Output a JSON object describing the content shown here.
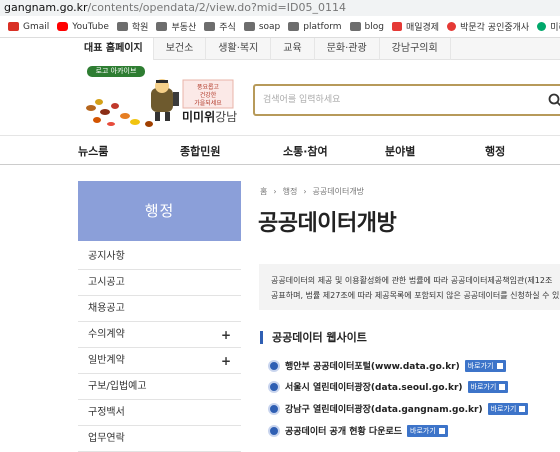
{
  "browser": {
    "url_host": "gangnam.go.kr",
    "url_path": "/contents/opendata/2/view.do?mid=ID05_0114",
    "bookmarks": [
      {
        "label": "Gmail",
        "icon": "gmail-icon",
        "color": "#d93025"
      },
      {
        "label": "YouTube",
        "icon": "youtube-icon",
        "color": "#ff0000"
      },
      {
        "label": "학원",
        "icon": "folder-icon"
      },
      {
        "label": "부동산",
        "icon": "folder-icon"
      },
      {
        "label": "주식",
        "icon": "folder-icon"
      },
      {
        "label": "soap",
        "icon": "folder-icon"
      },
      {
        "label": "platform",
        "icon": "folder-icon"
      },
      {
        "label": "blog",
        "icon": "folder-icon"
      },
      {
        "label": "매일경제",
        "icon": "maeil-icon",
        "color": "#e53935"
      },
      {
        "label": "박문각 공인중개사",
        "icon": "pmg-icon",
        "color": "#e53935"
      },
      {
        "label": "미리캔버스",
        "icon": "miricanvas-icon",
        "color": "#00a86b"
      }
    ]
  },
  "top_nav": [
    "대표 홈페이지",
    "보건소",
    "생활·복지",
    "교육",
    "문화·관광",
    "강남구의회"
  ],
  "header": {
    "logo_badge": "로고 아카이브",
    "logo_poem": [
      "풍요롭고",
      "건강한",
      "가을되세요"
    ],
    "brand_main": "미미위",
    "brand_sub": "강남",
    "search_placeholder": "검색어를 입력하세요"
  },
  "main_menu": [
    "뉴스룸",
    "종합민원",
    "소통·참여",
    "분야별",
    "행정"
  ],
  "sidebar": {
    "title": "행정",
    "items": [
      {
        "label": "공지사항",
        "plus": ""
      },
      {
        "label": "고시공고",
        "plus": ""
      },
      {
        "label": "채용공고",
        "plus": ""
      },
      {
        "label": "수의계약",
        "plus": "+"
      },
      {
        "label": "일반계약",
        "plus": "+"
      },
      {
        "label": "구보/입법예고",
        "plus": ""
      },
      {
        "label": "구정백서",
        "plus": ""
      },
      {
        "label": "업무연락",
        "plus": ""
      }
    ]
  },
  "breadcrumb": [
    "홈",
    "행정",
    "공공데이터개방"
  ],
  "page_title": "공공데이터개방",
  "description": [
    "공공데이터의 제공 및 이용활성화에 관한 법률에 따라 공공데이터제공책임관(제12조",
    "공표하며, 법률 제27조에 따라 제공목록에 포함되지 않은 공공데이터를 신청하실 수 있"
  ],
  "section_title": "공공데이터 웹사이트",
  "links": [
    {
      "label": "행안부 공공데이터포털(www.data.go.kr)",
      "button": "바로가기"
    },
    {
      "label": "서울시 열린데이터광장(data.seoul.go.kr)",
      "button": "바로가기"
    },
    {
      "label": "강남구 열린데이터광장(data.gangnam.go.kr)",
      "button": "바로가기"
    },
    {
      "label": "공공데이터 공개 현황 다운로드",
      "button": "바로가기"
    }
  ]
}
